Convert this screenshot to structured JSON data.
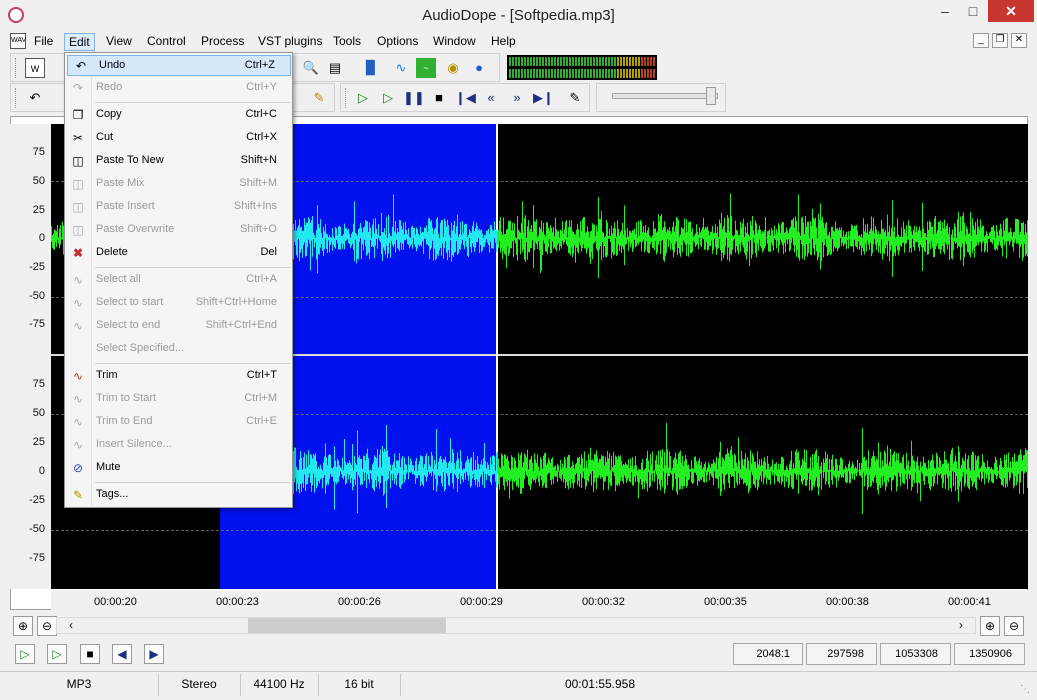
{
  "window": {
    "title": "AudioDope - [Softpedia.mp3]"
  },
  "menubar": [
    "File",
    "Edit",
    "View",
    "Control",
    "Process",
    "VST plugins",
    "Tools",
    "Options",
    "Window",
    "Help"
  ],
  "edit_menu": [
    {
      "label": "Undo",
      "shortcut": "Ctrl+Z",
      "enabled": true,
      "highlighted": true,
      "icon": "undo-icon"
    },
    {
      "label": "Redo",
      "shortcut": "Ctrl+Y",
      "enabled": false,
      "icon": "redo-icon"
    },
    {
      "label": "Copy",
      "shortcut": "Ctrl+C",
      "enabled": true,
      "icon": "copy-icon"
    },
    {
      "label": "Cut",
      "shortcut": "Ctrl+X",
      "enabled": true,
      "icon": "scissors-icon"
    },
    {
      "label": "Paste To New",
      "shortcut": "Shift+N",
      "enabled": true,
      "icon": "paste-icon"
    },
    {
      "label": "Paste Mix",
      "shortcut": "Shift+M",
      "enabled": false,
      "icon": "paste-icon"
    },
    {
      "label": "Paste Insert",
      "shortcut": "Shift+Ins",
      "enabled": false,
      "icon": "paste-icon"
    },
    {
      "label": "Paste Overwrite",
      "shortcut": "Shift+O",
      "enabled": false,
      "icon": "paste-icon"
    },
    {
      "label": "Delete",
      "shortcut": "Del",
      "enabled": true,
      "icon": "delete-icon"
    },
    {
      "label": "Select all",
      "shortcut": "Ctrl+A",
      "enabled": false,
      "icon": "wave-select-icon"
    },
    {
      "label": "Select to start",
      "shortcut": "Shift+Ctrl+Home",
      "enabled": false,
      "icon": "wave-select-icon"
    },
    {
      "label": "Select to end",
      "shortcut": "Shift+Ctrl+End",
      "enabled": false,
      "icon": "wave-select-icon"
    },
    {
      "label": "Select Specified...",
      "shortcut": "",
      "enabled": false,
      "icon": ""
    },
    {
      "label": "Trim",
      "shortcut": "Ctrl+T",
      "enabled": true,
      "icon": "trim-icon"
    },
    {
      "label": "Trim to Start",
      "shortcut": "Ctrl+M",
      "enabled": false,
      "icon": "trim-icon"
    },
    {
      "label": "Trim to End",
      "shortcut": "Ctrl+E",
      "enabled": false,
      "icon": "trim-icon"
    },
    {
      "label": "Insert Silence...",
      "shortcut": "",
      "enabled": false,
      "icon": "silence-icon"
    },
    {
      "label": "Mute",
      "shortcut": "",
      "enabled": true,
      "icon": "mute-icon"
    },
    {
      "label": "Tags...",
      "shortcut": "",
      "enabled": true,
      "icon": "tags-icon"
    }
  ],
  "y_axis_labels": [
    "75",
    "50",
    "25",
    "0",
    "-25",
    "-50",
    "-75"
  ],
  "timeline_labels": [
    "00:00:20",
    "00:00:23",
    "00:00:26",
    "00:00:29",
    "00:00:32",
    "00:00:35",
    "00:00:38",
    "00:00:41"
  ],
  "counters": [
    "2048:1",
    "297598",
    "1053308",
    "1350906"
  ],
  "status": {
    "format": "MP3",
    "channels": "Stereo",
    "sample_rate": "44100 Hz",
    "bit_depth": "16 bit",
    "duration": "00:01:55.958"
  },
  "colors": {
    "selection": "#0011ee",
    "wave_selected": "#22e8f0",
    "wave_unselected": "#22ee22",
    "background": "#000000"
  }
}
